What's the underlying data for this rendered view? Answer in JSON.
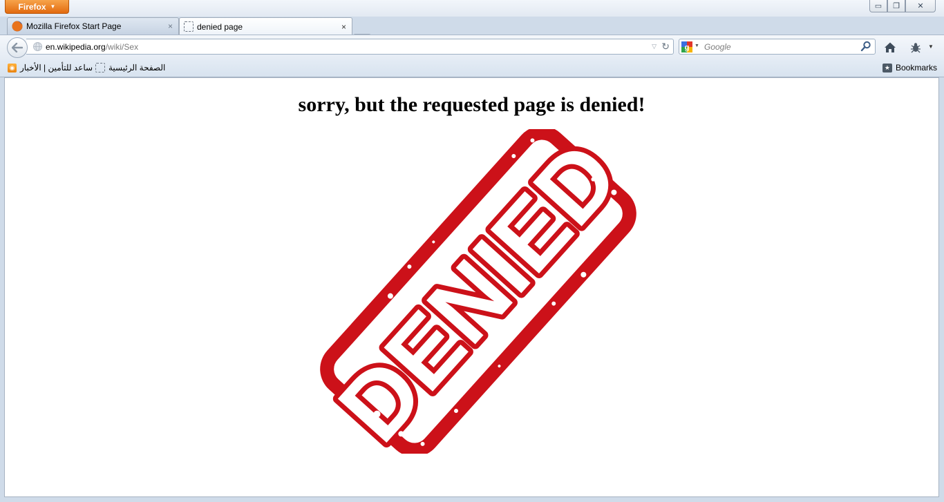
{
  "window": {
    "app_button_label": "Firefox",
    "controls": {
      "minimize": "▭",
      "restore": "❐",
      "close": "✕"
    }
  },
  "tabs": [
    {
      "label": "Mozilla Firefox Start Page",
      "active": false,
      "icon": "firefox-logo-icon",
      "close": "×"
    },
    {
      "label": "denied page",
      "active": true,
      "icon": "blank-page-icon",
      "close": "×"
    }
  ],
  "new_tab_label": "+",
  "navbar": {
    "back_icon": "back-arrow-icon",
    "url_host": "en.wikipedia.org",
    "url_path": "/wiki/Sex",
    "search_placeholder": "Google",
    "search_engine_icon": "google-icon"
  },
  "bookmarks_bar": {
    "items": [
      {
        "label": "ساعد للتأمين | الأخبار",
        "icon": "rss-feed-icon"
      },
      {
        "label": "الصفحة الرئيسية",
        "icon": "blank-page-icon"
      }
    ],
    "bookmarks_label": "Bookmarks"
  },
  "page": {
    "heading": "sorry, but the requested page is denied!",
    "stamp_text": "DENIED",
    "stamp_color": "#cc1119"
  },
  "colors": {
    "firefox_orange": "#e26a0f",
    "chrome_blue": "#cfdbe9"
  }
}
